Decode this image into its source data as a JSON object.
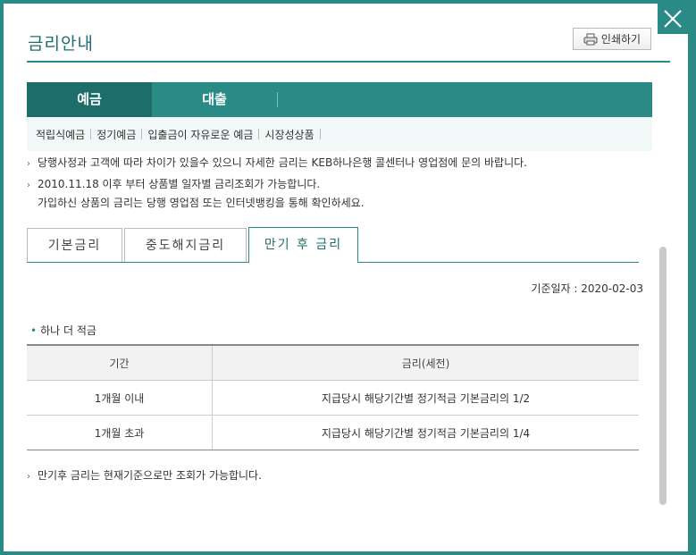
{
  "window": {
    "title": "금리안내",
    "print_label": "인쇄하기",
    "close_icon": "close-icon"
  },
  "main_tabs": [
    {
      "label": "예금",
      "active": true
    },
    {
      "label": "대출",
      "active": false
    }
  ],
  "sub_nav": [
    "적립식예금",
    "정기예금",
    "입출금이 자유로운 예금",
    "시장성상품"
  ],
  "notices": [
    "당행사정과 고객에 따라 차이가 있을수 있으니 자세한 금리는 KEB하나은행 콜센터나 영업점에 문의 바랍니다.",
    "2010.11.18 이후 부터 상품별 일자별 금리조회가 가능합니다.",
    "가입하신 상품의 금리는 당행 영업점 또는 인터넷뱅킹을 통해 확인하세요."
  ],
  "rate_tabs": [
    {
      "label": "기본금리",
      "active": false
    },
    {
      "label": "중도해지금리",
      "active": false
    },
    {
      "label": "만기 후 금리",
      "active": true
    }
  ],
  "base_date": "기준일자 : 2020-02-03",
  "product_name": "하나 더 적금",
  "table": {
    "headers": [
      "기간",
      "금리(세전)"
    ],
    "rows": [
      [
        "1개월 이내",
        "지급당시 해당기간별 정기적금 기본금리의 1/2"
      ],
      [
        "1개월 초과",
        "지급당시 해당기간별 정기적금 기본금리의 1/4"
      ]
    ]
  },
  "footnote": "만기후 금리는 현재기준으로만 조회가 가능합니다.",
  "colors": {
    "accent": "#2a8a86",
    "accent_dark": "#1d6e6b",
    "subnav_bg": "#f1f8f8"
  }
}
